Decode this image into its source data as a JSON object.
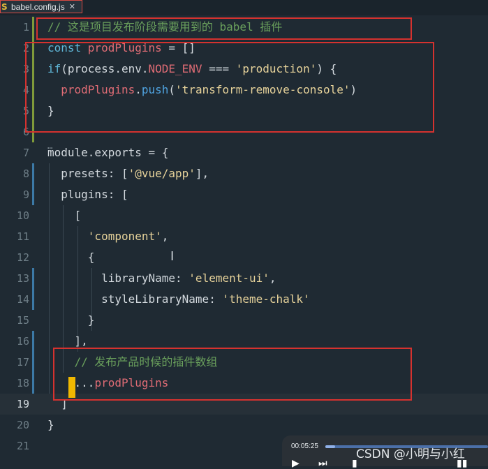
{
  "tab": {
    "icon": "js-file-icon",
    "icon_glyph": "S",
    "label": "babel.config.js",
    "close": "✕"
  },
  "lines": [
    {
      "n": "1",
      "tokens": [
        {
          "t": "// 这是项目发布阶段需要用到的 babel 插件",
          "c": "com"
        }
      ]
    },
    {
      "n": "2",
      "tokens": [
        {
          "t": "const ",
          "c": "kw"
        },
        {
          "t": "prodPlugins",
          "c": "var"
        },
        {
          "t": " = []",
          "c": "def"
        }
      ]
    },
    {
      "n": "3",
      "tokens": [
        {
          "t": "if",
          "c": "kw"
        },
        {
          "t": "(process.env.",
          "c": "def"
        },
        {
          "t": "NODE_ENV",
          "c": "var"
        },
        {
          "t": " === ",
          "c": "def"
        },
        {
          "t": "'production'",
          "c": "str"
        },
        {
          "t": ") {",
          "c": "def"
        }
      ]
    },
    {
      "n": "4",
      "tokens": [
        {
          "t": "  ",
          "c": "def"
        },
        {
          "t": "prodPlugins",
          "c": "var"
        },
        {
          "t": ".",
          "c": "def"
        },
        {
          "t": "push",
          "c": "fn"
        },
        {
          "t": "(",
          "c": "def"
        },
        {
          "t": "'transform-remove-console'",
          "c": "str"
        },
        {
          "t": ")",
          "c": "def"
        }
      ]
    },
    {
      "n": "5",
      "tokens": [
        {
          "t": "}",
          "c": "def"
        }
      ]
    },
    {
      "n": "6",
      "tokens": []
    },
    {
      "n": "7",
      "tokens": [
        {
          "t": "module.exports = {",
          "c": "def"
        }
      ]
    },
    {
      "n": "8",
      "tokens": [
        {
          "t": "  presets: [",
          "c": "def"
        },
        {
          "t": "'@vue/app'",
          "c": "str"
        },
        {
          "t": "],",
          "c": "def"
        }
      ]
    },
    {
      "n": "9",
      "tokens": [
        {
          "t": "  plugins: [",
          "c": "def"
        }
      ]
    },
    {
      "n": "10",
      "tokens": [
        {
          "t": "    [",
          "c": "def"
        }
      ]
    },
    {
      "n": "11",
      "tokens": [
        {
          "t": "      ",
          "c": "def"
        },
        {
          "t": "'component'",
          "c": "str"
        },
        {
          "t": ",",
          "c": "def"
        }
      ]
    },
    {
      "n": "12",
      "tokens": [
        {
          "t": "      {",
          "c": "def"
        }
      ]
    },
    {
      "n": "13",
      "tokens": [
        {
          "t": "        libraryName: ",
          "c": "def"
        },
        {
          "t": "'element-ui'",
          "c": "str"
        },
        {
          "t": ",",
          "c": "def"
        }
      ]
    },
    {
      "n": "14",
      "tokens": [
        {
          "t": "        styleLibraryName: ",
          "c": "def"
        },
        {
          "t": "'theme-chalk'",
          "c": "str"
        }
      ]
    },
    {
      "n": "15",
      "tokens": [
        {
          "t": "      }",
          "c": "def"
        }
      ]
    },
    {
      "n": "16",
      "tokens": [
        {
          "t": "    ],",
          "c": "def"
        }
      ]
    },
    {
      "n": "17",
      "tokens": [
        {
          "t": "    // 发布产品时候的插件数组",
          "c": "com"
        }
      ]
    },
    {
      "n": "18",
      "tokens": [
        {
          "t": "    ...",
          "c": "def"
        },
        {
          "t": "prodPlugins",
          "c": "var"
        }
      ]
    },
    {
      "n": "19",
      "tokens": [
        {
          "t": "  ]",
          "c": "def"
        }
      ]
    },
    {
      "n": "20",
      "tokens": [
        {
          "t": "}",
          "c": "def"
        }
      ]
    },
    {
      "n": "21",
      "tokens": []
    }
  ],
  "current_line": "19",
  "gutter_marks": {
    "green": [
      "1",
      "2",
      "3",
      "4",
      "5",
      "6"
    ],
    "blue": [
      "8",
      "9",
      "13",
      "14",
      "16",
      "17",
      "18"
    ]
  },
  "fold_dots": "⋯",
  "colors": {
    "com": "#6aa05c",
    "kw": "#5fb7d8",
    "var": "#e06c75",
    "fn": "#4fa3e0",
    "str": "#e6d29a",
    "def": "#d3d9de",
    "highlight_box": "#d5322f",
    "cursor": "#f0b800"
  },
  "player": {
    "time": "00:05:25",
    "progress": 0.06,
    "controls": [
      "play-icon",
      "next-icon",
      "volume-icon",
      "menu-icon"
    ]
  },
  "watermark": "CSDN @小明与小红"
}
